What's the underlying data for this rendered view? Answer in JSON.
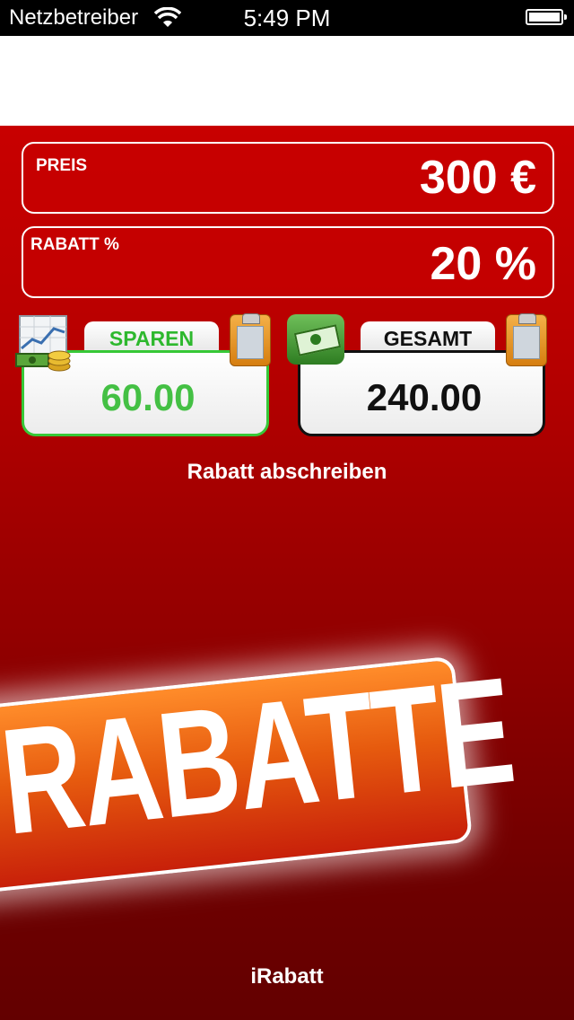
{
  "status_bar": {
    "carrier": "Netzbetreiber",
    "time": "5:49 PM"
  },
  "price_field": {
    "label": "PREIS",
    "value": "300 €"
  },
  "discount_field": {
    "label": "RABATT %",
    "value": "20 %"
  },
  "save_card": {
    "label": "SPAREN",
    "value": "60.00"
  },
  "total_card": {
    "label": "GESAMT",
    "value": "240.00"
  },
  "copy_button": {
    "label": "Rabatt abschreiben"
  },
  "banner": {
    "text": "RABATTE"
  },
  "footer": {
    "app_name": "iRabatt"
  },
  "icons": {
    "wifi": "wifi-icon",
    "battery": "battery-icon",
    "chart_coins": "chart-coins-icon",
    "money": "money-icon",
    "clipboard": "clipboard-icon"
  },
  "colors": {
    "background_red": "#c80000",
    "save_green": "#44c044",
    "banner_orange": "#e65a0e"
  }
}
